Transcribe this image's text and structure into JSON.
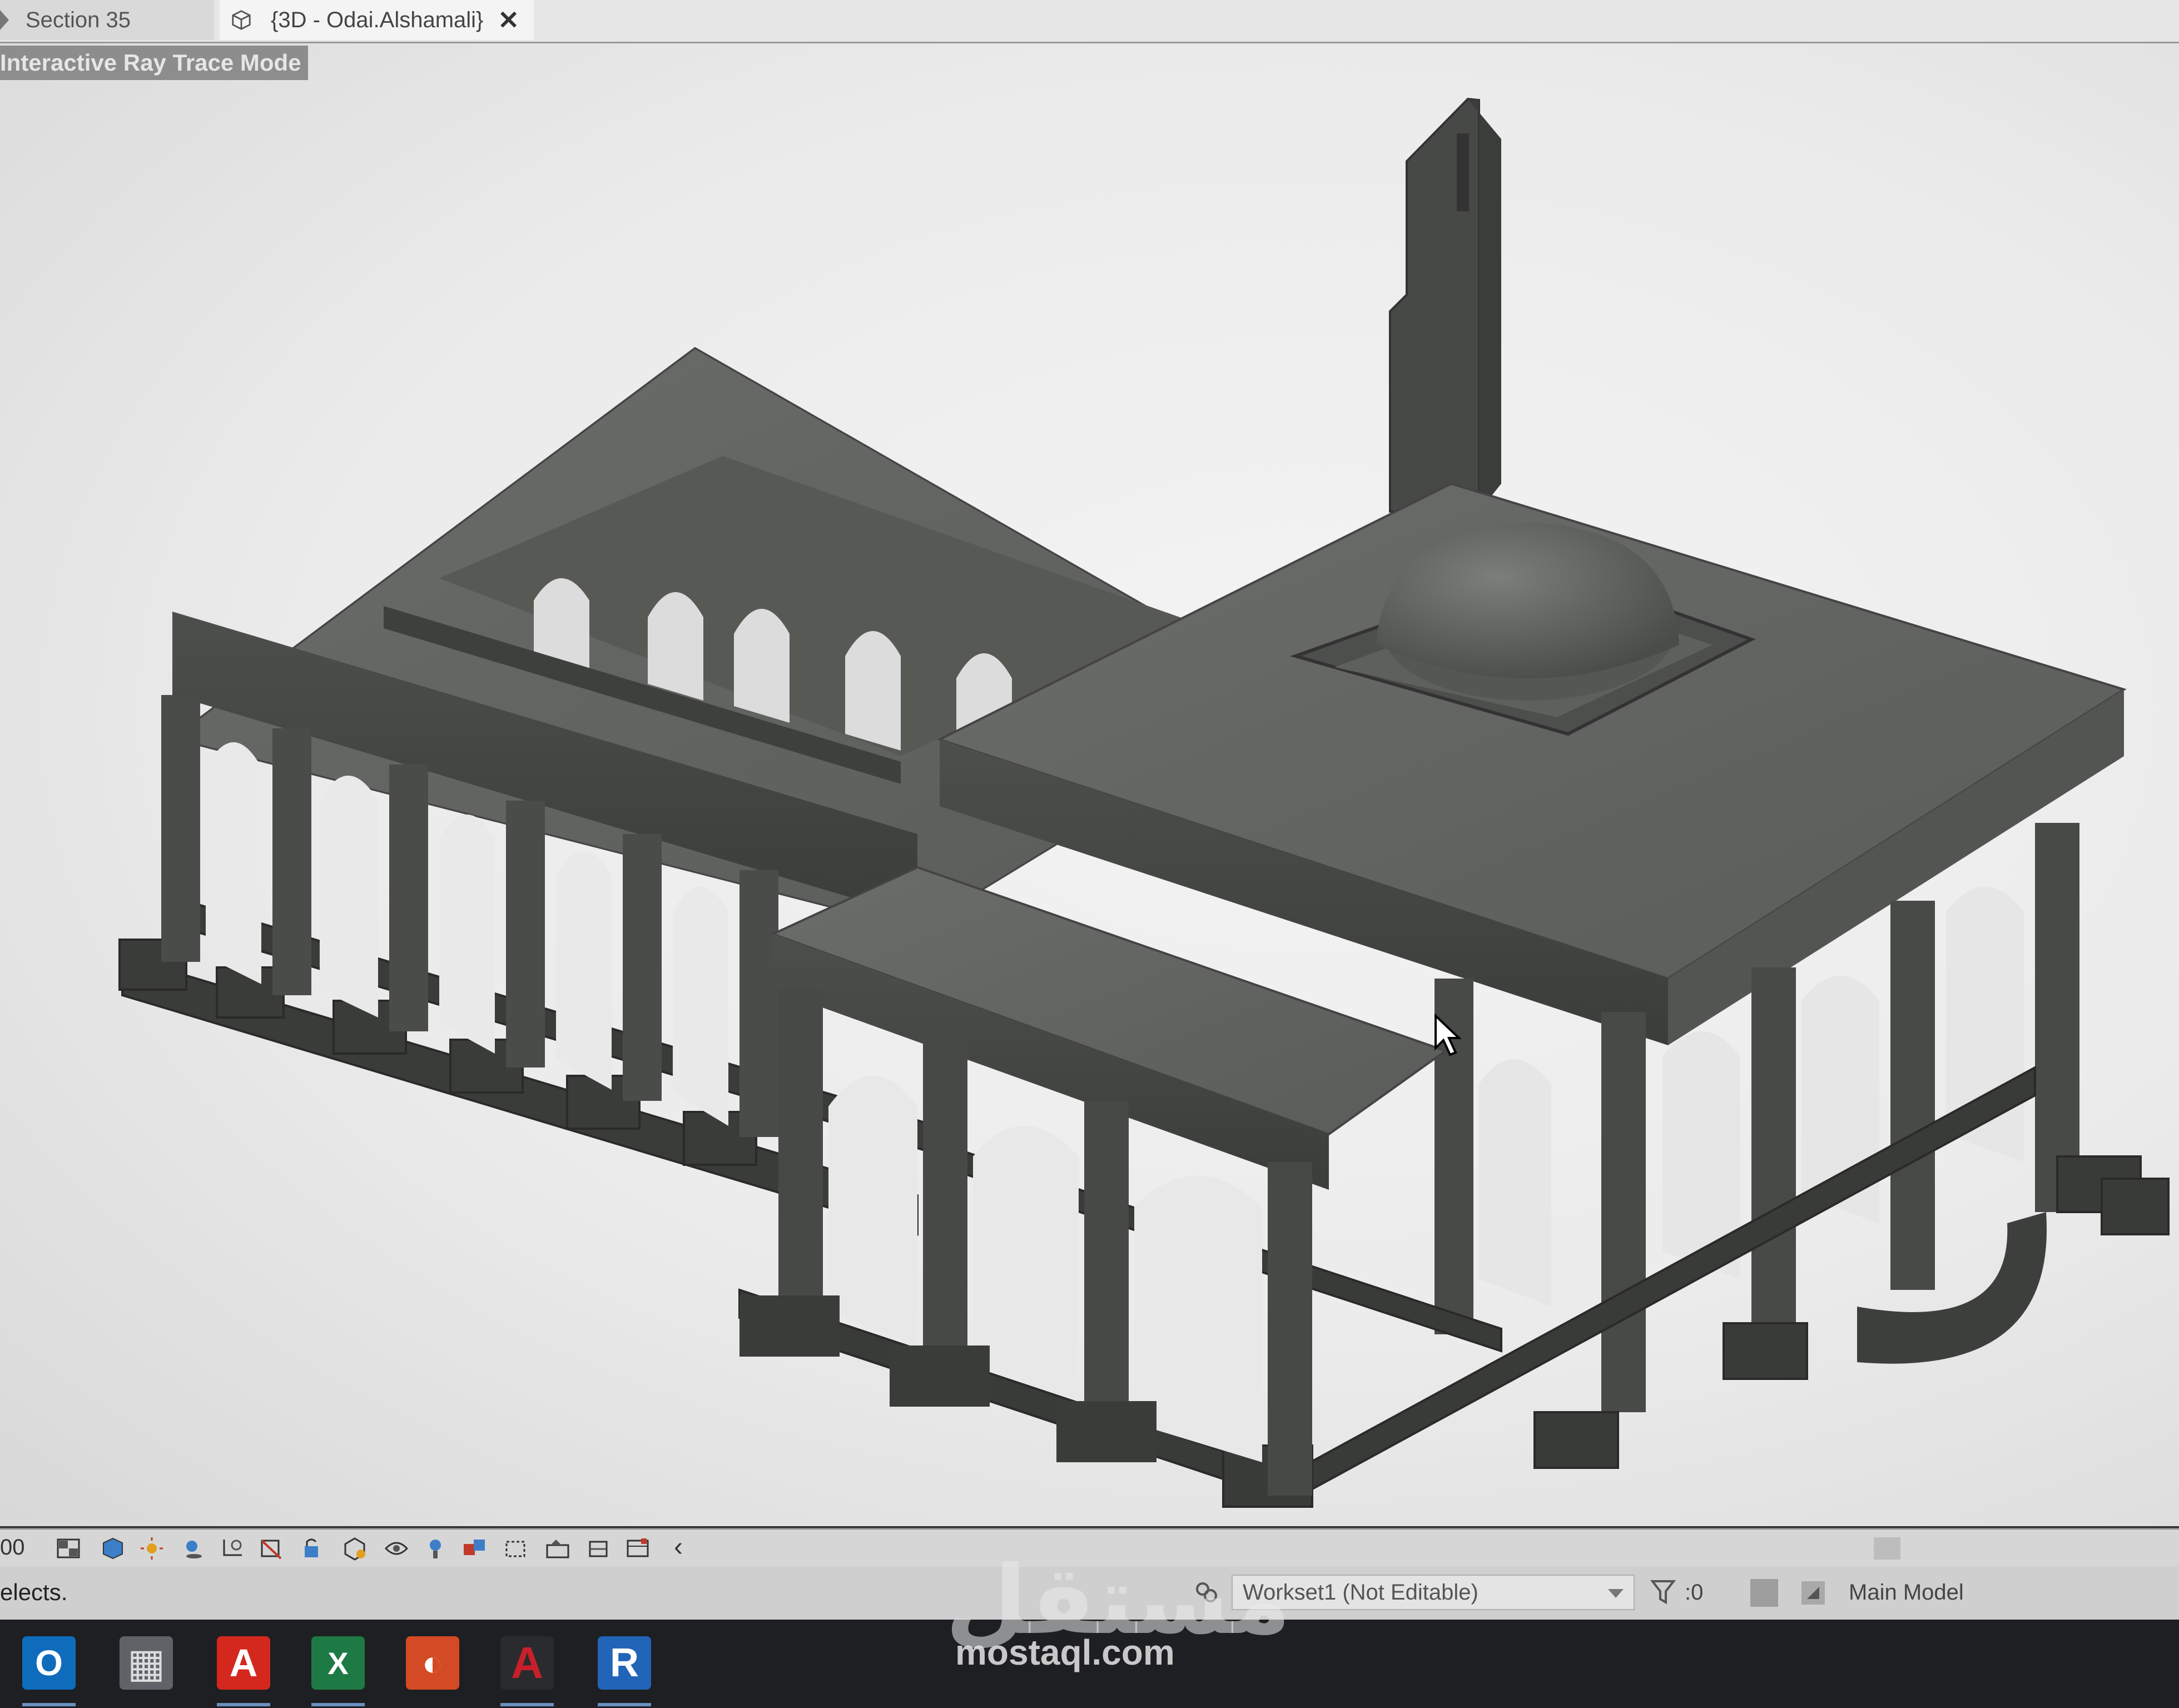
{
  "tabs": [
    {
      "label": "Section 35",
      "active": false
    },
    {
      "label": "{3D - Odai.Alshamali}",
      "active": true,
      "close_glyph": "✕"
    }
  ],
  "viewport": {
    "mode_label": "Interactive Ray Trace Mode",
    "content": "3d-mosque-model"
  },
  "view_control_bar": {
    "scale_text": "00",
    "icons": [
      "view-cube-icon",
      "detail-level-icon",
      "visual-style-icon",
      "sun-path-icon",
      "shadows-icon",
      "crop-view-icon",
      "show-crop-icon",
      "unlock-3d-icon",
      "temporary-hide-icon",
      "reveal-hidden-icon",
      "temporary-properties-icon",
      "worksharing-display-icon",
      "analytical-model-icon",
      "highlight-displacement-icon",
      "reveal-constraints-icon",
      "render-icon"
    ],
    "collapse_glyph": "‹"
  },
  "status_bar": {
    "message": "elects.",
    "workset": "Workset1 (Not Editable)",
    "filter_count": ":0",
    "design_option": "Main Model"
  },
  "taskbar": {
    "apps": [
      {
        "name": "outlook",
        "glyph": "O",
        "color": "#0f6cbd"
      },
      {
        "name": "calculator",
        "glyph": "▦",
        "color": "#5f6368"
      },
      {
        "name": "acrobat",
        "glyph": "A",
        "color": "#d4281f"
      },
      {
        "name": "excel",
        "glyph": "X",
        "color": "#1d7a45"
      },
      {
        "name": "powerpoint-like",
        "glyph": "◐",
        "color": "#d34a24"
      },
      {
        "name": "autocad",
        "glyph": "A",
        "color": "#c8202a"
      },
      {
        "name": "revit",
        "glyph": "R",
        "color": "#2264b8"
      }
    ]
  },
  "watermark": {
    "arabic": "مستقل",
    "latin": "mostaql.com"
  }
}
